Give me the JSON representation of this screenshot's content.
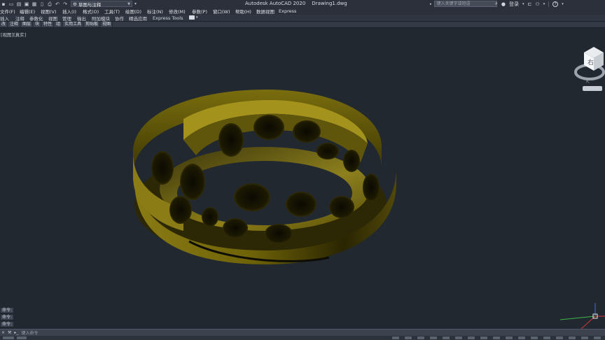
{
  "title_bar": {
    "workspace_combo": "草图与注释",
    "app_name": "Autodesk AutoCAD 2020",
    "file_name": "Drawing1.dwg",
    "search_placeholder": "键入关键字或短语",
    "sign_in": "登录",
    "help": "?"
  },
  "menu_bar": {
    "items": [
      "文件(F)",
      "编辑(E)",
      "视图(V)",
      "插入(I)",
      "格式(O)",
      "工具(T)",
      "绘图(D)",
      "标注(N)",
      "修改(M)",
      "参数(P)",
      "窗口(W)",
      "帮助(H)",
      "数据视图",
      "Express"
    ]
  },
  "ribbon": {
    "tabs": [
      "插入",
      "注释",
      "参数化",
      "视图",
      "管理",
      "输出",
      "附加模块",
      "协作",
      "精选应用",
      "Express Tools"
    ]
  },
  "panels": {
    "items": [
      "改",
      "注释",
      "图层",
      "块",
      "特性",
      "组",
      "实用工具",
      "剪贴板",
      "视图"
    ]
  },
  "viewport": {
    "label": "[视图][真实]",
    "viewcube_face": "右"
  },
  "command_history": [
    "命令:",
    "命令:",
    "命令:"
  ],
  "command_line": {
    "close": "×",
    "prompt": "键入命令"
  },
  "colors": {
    "background": "#212830",
    "model": "#8a7a12",
    "ucs_x": "#d23a3a",
    "ucs_y": "#3fb84a"
  }
}
